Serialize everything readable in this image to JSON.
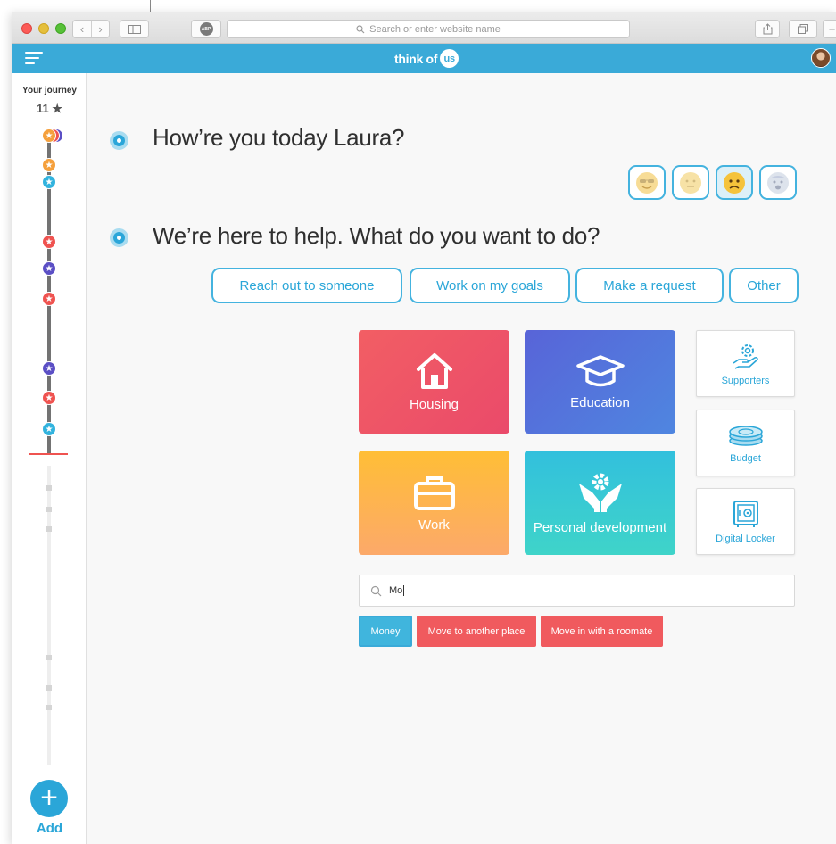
{
  "browser": {
    "address_placeholder": "Search or enter website name",
    "adblock_badge": "ABP",
    "new_tab_glyph": "+"
  },
  "header": {
    "brand_text": "think of",
    "brand_badge": "us"
  },
  "journey": {
    "title": "Your journey",
    "count": "11 ★",
    "star_glyph": "★",
    "add_label": "Add",
    "add_glyph": "+"
  },
  "greeting": {
    "question": "How’re you today Laura?",
    "moods": [
      "cool-face-icon",
      "neutral-face-icon",
      "frowning-face-icon",
      "anxious-face-icon"
    ],
    "selected_mood": "frowning-face-icon"
  },
  "help": {
    "question": "We’re here to help. What do you want to do?",
    "actions": [
      "Reach out to someone",
      "Work on my goals",
      "Make a request",
      "Other"
    ]
  },
  "categories": [
    {
      "label": "Housing",
      "icon": "house-icon"
    },
    {
      "label": "Education",
      "icon": "graduation-cap-icon"
    },
    {
      "label": "Work",
      "icon": "briefcase-icon"
    },
    {
      "label": "Personal development",
      "icon": "hands-gear-icon"
    }
  ],
  "tools": [
    {
      "label": "Supporters",
      "icon": "hand-gear-icon"
    },
    {
      "label": "Budget",
      "icon": "coins-icon"
    },
    {
      "label": "Digital Locker",
      "icon": "safe-icon"
    }
  ],
  "search": {
    "value": "Mo"
  },
  "suggestions": [
    "Money",
    "Move to another place",
    "Move in with a roomate"
  ],
  "colors": {
    "brand_blue": "#3aaad8",
    "accent_red": "#f05a5e",
    "star_orange": "#f5a03c",
    "star_purple": "#5b4fc5"
  }
}
